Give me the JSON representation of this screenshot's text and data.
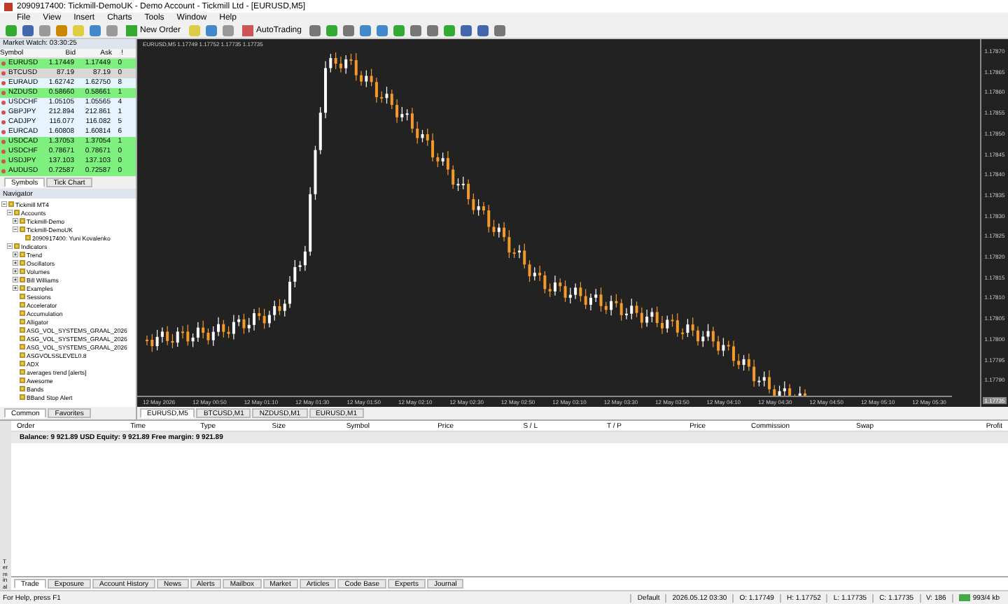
{
  "window": {
    "title": "2090917400: Tickmill-DemoUK - Demo Account - Tickmill Ltd - [EURUSD,M5]"
  },
  "menu": [
    "File",
    "View",
    "Insert",
    "Charts",
    "Tools",
    "Window",
    "Help"
  ],
  "toolbar": {
    "new_order": "New Order",
    "autotrading": "AutoTrading"
  },
  "market_watch": {
    "title": "Market Watch: 03:30:25",
    "columns": [
      "Symbol",
      "Bid",
      "Ask",
      "!"
    ],
    "rows": [
      {
        "symbol": "EURUSD",
        "bid": "1.17449",
        "ask": "1.17449",
        "spread": "0",
        "color": "#7ef07e"
      },
      {
        "symbol": "BTCUSD",
        "bid": "87.19",
        "ask": "87.19",
        "spread": "0",
        "color": "#d8d8d8"
      },
      {
        "symbol": "EURAUD",
        "bid": "1.62742",
        "ask": "1.62750",
        "spread": "8",
        "color": "#e6f4ff"
      },
      {
        "symbol": "NZDUSD",
        "bid": "0.58660",
        "ask": "0.58661",
        "spread": "1",
        "color": "#7ef07e"
      },
      {
        "symbol": "USDCHF",
        "bid": "1.05105",
        "ask": "1.05565",
        "spread": "4",
        "color": "#e6f4ff"
      },
      {
        "symbol": "GBPJPY",
        "bid": "212.894",
        "ask": "212.861",
        "spread": "1",
        "color": "#e6f4ff"
      },
      {
        "symbol": "CADJPY",
        "bid": "116.077",
        "ask": "116.082",
        "spread": "5",
        "color": "#e6f4ff"
      },
      {
        "symbol": "EURCAD",
        "bid": "1.60808",
        "ask": "1.60814",
        "spread": "6",
        "color": "#e6f4ff"
      },
      {
        "symbol": "USDCAD",
        "bid": "1.37053",
        "ask": "1.37054",
        "spread": "1",
        "color": "#7ef07e"
      },
      {
        "symbol": "USDCHF",
        "bid": "0.78671",
        "ask": "0.78671",
        "spread": "0",
        "color": "#7ef07e"
      },
      {
        "symbol": "USDJPY",
        "bid": "137.103",
        "ask": "137.103",
        "spread": "0",
        "color": "#7ef07e"
      },
      {
        "symbol": "AUDUSD",
        "bid": "0.72587",
        "ask": "0.72587",
        "spread": "0",
        "color": "#7ef07e"
      }
    ],
    "tabs": [
      {
        "label": "Symbols",
        "selected": true
      },
      {
        "label": "Tick Chart",
        "selected": false
      }
    ]
  },
  "navigator": {
    "title": "Navigator",
    "tree": [
      {
        "label": "Tickmill MT4",
        "expanded": true,
        "children": [
          {
            "label": "Accounts",
            "expanded": true,
            "children": [
              {
                "label": "Tickmill-Demo",
                "expanded": false
              },
              {
                "label": "Tickmill-DemoUK",
                "expanded": true,
                "children": [
                  {
                    "label": "2090917400: Yuni Kovalenko"
                  }
                ]
              }
            ]
          },
          {
            "label": "Indicators",
            "expanded": true,
            "children": [
              {
                "label": "Trend",
                "expanded": false
              },
              {
                "label": "Oscillators",
                "expanded": false
              },
              {
                "label": "Volumes",
                "expanded": false
              },
              {
                "label": "Bill Williams",
                "expanded": false
              },
              {
                "label": "Examples",
                "expanded": false
              },
              {
                "label": "Sessions"
              },
              {
                "label": "Accelerator"
              },
              {
                "label": "Accumulation"
              },
              {
                "label": "Alligator"
              },
              {
                "label": "ASG_VOL_SYSTEMS_GRAAL_2026"
              },
              {
                "label": "ASG_VOL_SYSTEMS_GRAAL_2026"
              },
              {
                "label": "ASG_VOL_SYSTEMS_GRAAL_2026"
              },
              {
                "label": "ASGVOLSSLEVEL0.8"
              },
              {
                "label": "ADX"
              },
              {
                "label": "averages trend [alerts]"
              },
              {
                "label": "Awesome"
              },
              {
                "label": "Bands"
              },
              {
                "label": "BBand Stop Alert"
              }
            ]
          }
        ]
      }
    ],
    "tabs": [
      {
        "label": "Common",
        "selected": true
      },
      {
        "label": "Favorites",
        "selected": false
      }
    ]
  },
  "chart": {
    "header": "EURUSD,M5 1.17749 1.17752 1.17735 1.17735",
    "price_labels": [
      "1.17870",
      "1.17865",
      "1.17860",
      "1.17855",
      "1.17850",
      "1.17845",
      "1.17840",
      "1.17835",
      "1.17830",
      "1.17825",
      "1.17820",
      "1.17815",
      "1.17810",
      "1.17805",
      "1.17800",
      "1.17795",
      "1.17790"
    ],
    "current_price": "1.17735",
    "time_labels": [
      "12 May 2026",
      "12 May 00:50",
      "12 May 01:10",
      "12 May 01:30",
      "12 May 01:50",
      "12 May 02:10",
      "12 May 02:30",
      "12 May 02:50",
      "12 May 03:10",
      "12 May 03:30",
      "12 May 03:50",
      "12 May 04:10",
      "12 May 04:30",
      "12 May 04:50",
      "12 May 05:10",
      "12 May 05:30"
    ],
    "tabs": [
      {
        "label": "EURUSD,M5",
        "selected": true
      },
      {
        "label": "BTCUSD,M1",
        "selected": false
      },
      {
        "label": "NZDUSD,M1",
        "selected": false
      },
      {
        "label": "EURUSD,M1",
        "selected": false
      }
    ]
  },
  "terminal": {
    "columns": [
      "Order",
      "Time",
      "Type",
      "Size",
      "Symbol",
      "Price",
      "S / L",
      "T / P",
      "Price",
      "Commission",
      "Swap",
      "Profit"
    ],
    "balance": "Balance: 9 921.89 USD  Equity: 9 921.89  Free margin: 9 921.89",
    "side_label": "Terminal",
    "tabs": [
      {
        "label": "Trade",
        "selected": true
      },
      {
        "label": "Exposure",
        "selected": false
      },
      {
        "label": "Account History",
        "selected": false
      },
      {
        "label": "News",
        "selected": false
      },
      {
        "label": "Alerts",
        "selected": false
      },
      {
        "label": "Mailbox",
        "selected": false
      },
      {
        "label": "Market",
        "selected": false
      },
      {
        "label": "Articles",
        "selected": false
      },
      {
        "label": "Code Base",
        "selected": false
      },
      {
        "label": "Experts",
        "selected": false
      },
      {
        "label": "Journal",
        "selected": false
      }
    ]
  },
  "status_bar": {
    "help": "For Help, press F1",
    "profile": "Default",
    "time": "2026.05.12 03:30",
    "open": "O: 1.17749",
    "high": "H: 1.17752",
    "low": "L: 1.17735",
    "close": "C: 1.17735",
    "volume": "V: 186",
    "traffic": "993/4 kb"
  }
}
